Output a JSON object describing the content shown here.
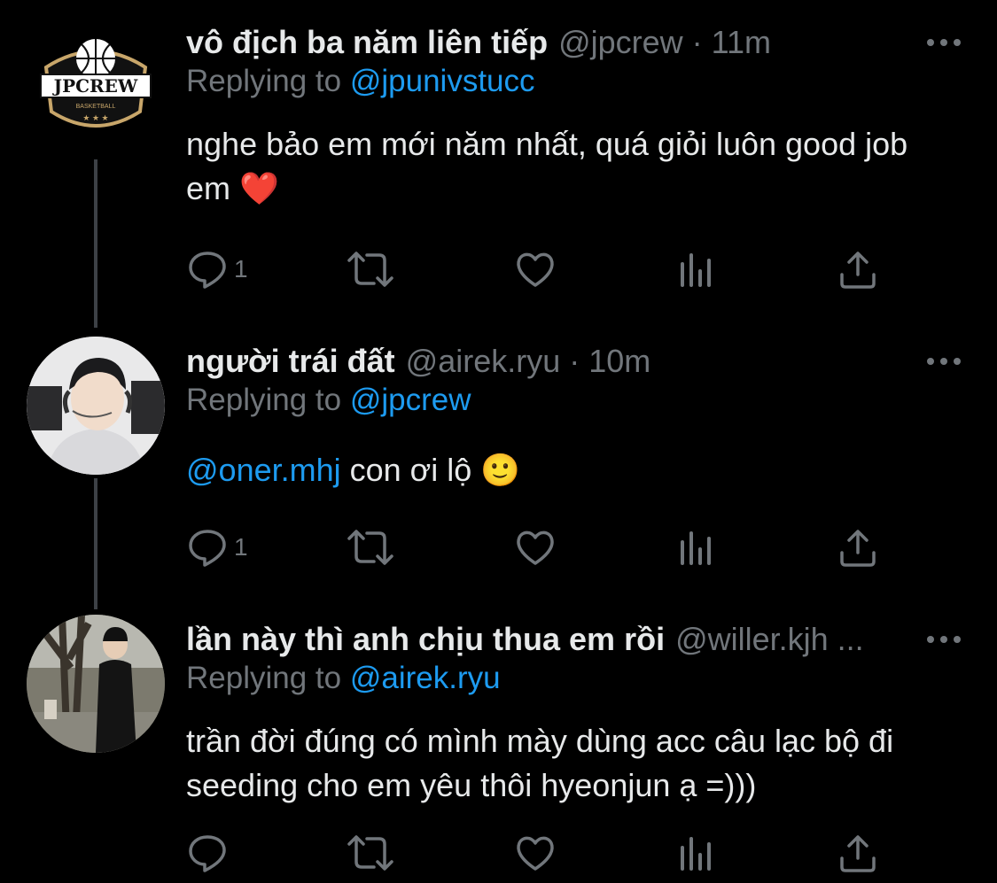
{
  "tweets": [
    {
      "name": "vô địch ba năm liên tiếp",
      "handle": "@jpcrew",
      "separator": "·",
      "time": "11m",
      "replying_prefix": "Replying to",
      "replying_to": "@jpunivstucc",
      "body_text": "nghe bảo em mới năm nhất, quá giỏi luôn good job em ❤️",
      "reply_count": "1",
      "avatar_logo_text": "JPCREW",
      "avatar_logo_subtext": "BASKETBALL"
    },
    {
      "name": "người trái đất",
      "handle": "@airek.ryu",
      "separator": "·",
      "time": "10m",
      "replying_prefix": "Replying to",
      "replying_to": "@jpcrew",
      "body_mention": "@oner.mhj",
      "body_text": "con ơi lộ 🙂",
      "reply_count": "1"
    },
    {
      "name": "lần này thì anh chịu thua em rồi",
      "handle": "@willer.kjh ...",
      "replying_prefix": "Replying to",
      "replying_to": "@airek.ryu",
      "body_text": "trần đời đúng có mình mày dùng acc câu lạc bộ đi seeding cho em yêu thôi hyeonjun ạ =)))",
      "reply_count": ""
    }
  ],
  "icons": {
    "more": "more-horizontal-icon",
    "reply": "reply-icon",
    "retweet": "retweet-icon",
    "like": "heart-icon",
    "views": "views-icon",
    "share": "share-icon"
  },
  "colors": {
    "background": "#000000",
    "text": "#e7e9ea",
    "muted": "#71767b",
    "link": "#1d9bf0",
    "thread_line": "#3d4146",
    "logo_gold": "#c8a66a"
  }
}
